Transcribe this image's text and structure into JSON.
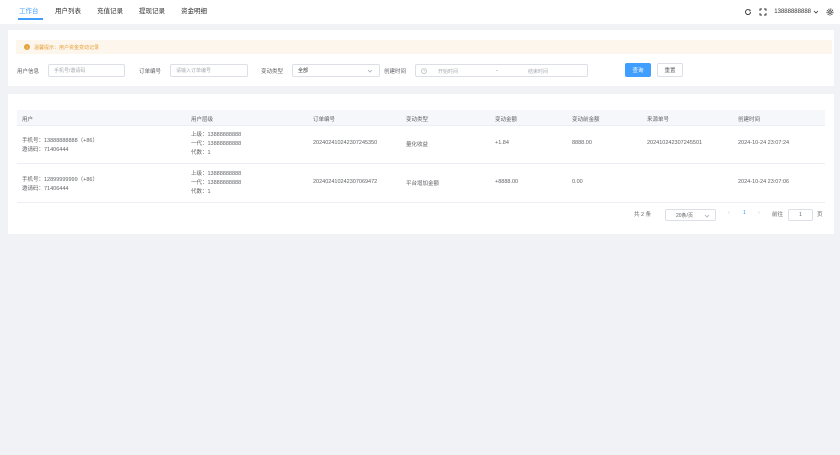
{
  "nav": {
    "tabs": [
      {
        "label": "工作台"
      },
      {
        "label": "用户列表"
      },
      {
        "label": "充值记录"
      },
      {
        "label": "提现记录"
      },
      {
        "label": "资金明细"
      }
    ],
    "user": "13888888888"
  },
  "tip": "温馨提示：用户资金变动记录",
  "filters": {
    "user_label": "用户信息",
    "user_placeholder": "手机号/邀请码",
    "order_label": "订单编号",
    "order_placeholder": "请输入订单编号",
    "type_label": "变动类型",
    "type_value": "全部",
    "time_label": "创建时间",
    "start_placeholder": "开始时间",
    "range_sep": "-",
    "end_placeholder": "结束时间",
    "query_button": "查询",
    "reset_button": "重置"
  },
  "table": {
    "columns": [
      "用户",
      "用户层级",
      "订单编号",
      "变动类型",
      "变动金额",
      "变动前金额",
      "来源单号",
      "创建时间"
    ],
    "rows": [
      {
        "phone": "手机号：13888888888（+86）",
        "invite": "邀请码：71406444",
        "level1": "上级：13888888888",
        "level2": "一代：13888888888",
        "level3": "代数：1",
        "order_no": "20240241024230724535​0",
        "type": "量化收益",
        "amount": "+1.84",
        "before": "8888.00",
        "source": "20241024230724550​1",
        "time": "2024-10-24 23:07:24"
      },
      {
        "phone": "手机号：12899999999（+86）",
        "invite": "邀请码：71406444",
        "level1": "上级：13888888888",
        "level2": "一代：13888888888",
        "level3": "代数：1",
        "order_no": "20240241024230706947​2",
        "type": "平台增加金额",
        "amount": "+8888.00",
        "before": "0.00",
        "source": "",
        "time": "2024-10-24 23:07:06"
      }
    ]
  },
  "pagination": {
    "total": "共 2 条",
    "page_size": "20条/页",
    "current_page": "1",
    "goto_label": "前往",
    "goto_value": "1",
    "page_suffix": "页"
  },
  "colors": {
    "accent": "#409eff",
    "warning": "#e6a23c"
  }
}
